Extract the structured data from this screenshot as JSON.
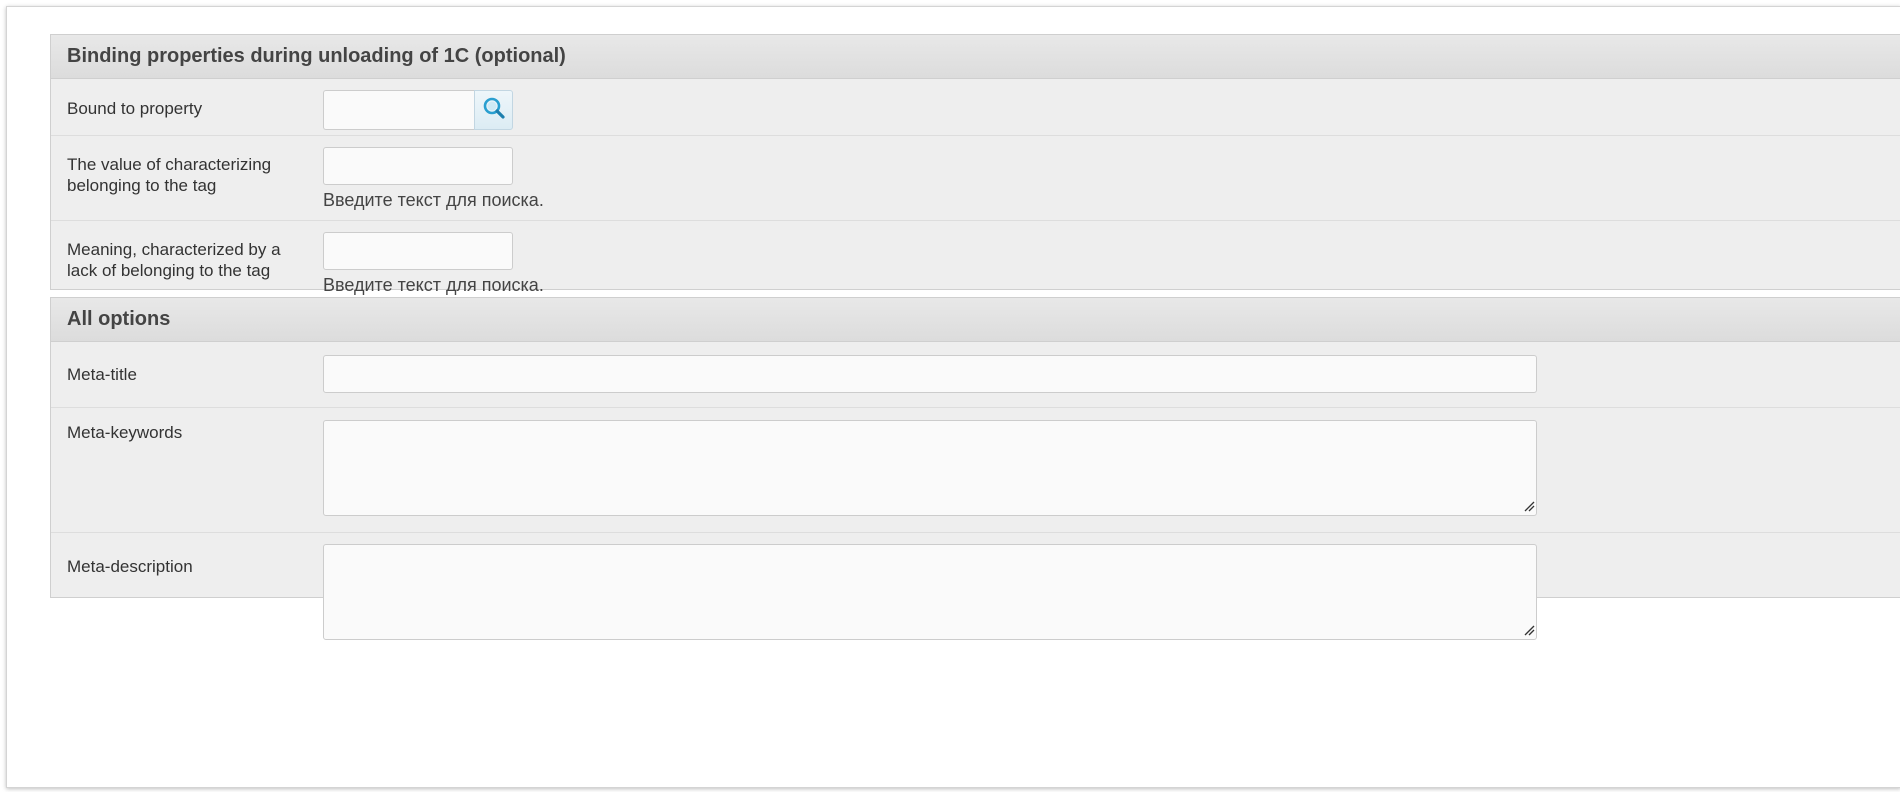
{
  "binding_section": {
    "title": "Binding properties during unloading of 1C (optional)",
    "rows": [
      {
        "label": "Bound to property",
        "value": "",
        "search_icon": "search-icon"
      },
      {
        "label_line1": "The value of characterizing",
        "label_line2": "belonging to the tag",
        "value": "",
        "hint": "Введите текст для поиска."
      },
      {
        "label_line1": "Meaning, characterized by a",
        "label_line2": "lack of belonging to the tag",
        "value": "",
        "hint": "Введите текст для поиска."
      }
    ]
  },
  "options_section": {
    "title": "All options",
    "rows": [
      {
        "label": "Meta-title",
        "value": ""
      },
      {
        "label": "Meta-keywords",
        "value": ""
      },
      {
        "label": "Meta-description",
        "value": ""
      }
    ]
  },
  "colors": {
    "section_bg": "#eeeeee",
    "header_bg": "#dcdcdc",
    "search_icon": "#2a9fd0"
  }
}
